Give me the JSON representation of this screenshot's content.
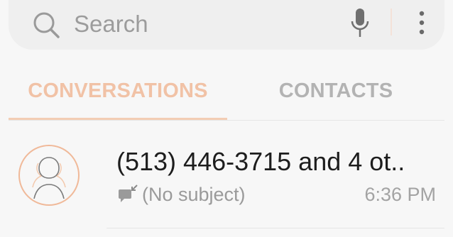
{
  "search": {
    "label": "Search",
    "icon": "search-icon",
    "voice_icon": "mic-icon",
    "more_icon": "more-vertical-icon"
  },
  "tabs": [
    {
      "label": "CONVERSATIONS",
      "selected": true
    },
    {
      "label": "CONTACTS",
      "selected": false
    }
  ],
  "conversations": [
    {
      "title": "(513) 446-3715 and 4 ot..",
      "subject": "(No subject)",
      "time": "6:36 PM",
      "avatar_icon": "group-avatar-icon",
      "type_icon": "mms-outgoing-icon"
    }
  ],
  "colors": {
    "accent": "#f1c2a6",
    "background": "#f7f7f7",
    "search_bg": "#efefef",
    "text_primary": "#1d1d1d",
    "text_secondary": "#9a9a9a"
  }
}
